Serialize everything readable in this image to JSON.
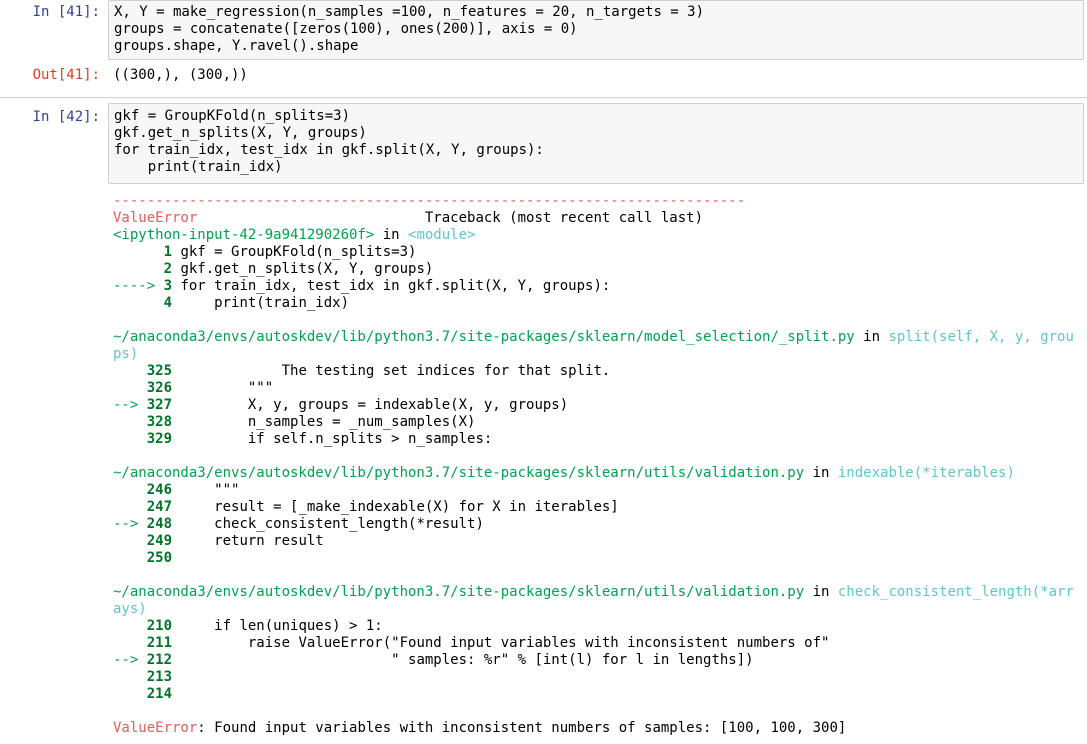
{
  "cell41": {
    "in_prompt": "In [41]:",
    "code": [
      "X, Y = make_regression(n_samples =100, n_features = 20, n_targets = 3)",
      "groups = concatenate([zeros(100), ones(200)], axis = 0)",
      "groups.shape, Y.ravel().shape"
    ],
    "out_prompt": "Out[41]:",
    "output": "((300,), (300,))"
  },
  "cell42": {
    "in_prompt": "In [42]:",
    "code": [
      "gkf = GroupKFold(n_splits=3)",
      "gkf.get_n_splits(X, Y, groups)",
      "for train_idx, test_idx in gkf.split(X, Y, groups):",
      "    print(train_idx)"
    ]
  },
  "traceback": {
    "dashes": "---------------------------------------------------------------------------",
    "error_name": "ValueError",
    "header_right": "Traceback (most recent call last)",
    "frame1": {
      "location": "<ipython-input-42-9a941290260f>",
      "in_word": " in ",
      "func": "<module>",
      "lines": [
        {
          "marker": "      ",
          "num": "1",
          "code": " gkf = GroupKFold(n_splits=3)"
        },
        {
          "marker": "      ",
          "num": "2",
          "code": " gkf.get_n_splits(X, Y, groups)"
        },
        {
          "marker": "----> ",
          "num": "3",
          "code": " for train_idx, test_idx in gkf.split(X, Y, groups):"
        },
        {
          "marker": "      ",
          "num": "4",
          "code": "     print(train_idx)"
        }
      ]
    },
    "frame2": {
      "path_line1": "~/anaconda3/envs/autoskdev/lib/python3.7/site-packages/sklearn/model_selection/_split.py",
      "in_word": " in ",
      "func_line1": "split(self, X, y, grou",
      "func_line2": "ps)",
      "lines": [
        {
          "marker": "    ",
          "num": "325",
          "code": "             The testing set indices for that split."
        },
        {
          "marker": "    ",
          "num": "326",
          "code": "         \"\"\""
        },
        {
          "marker": "--> ",
          "num": "327",
          "code": "         X, y, groups = indexable(X, y, groups)"
        },
        {
          "marker": "    ",
          "num": "328",
          "code": "         n_samples = _num_samples(X)"
        },
        {
          "marker": "    ",
          "num": "329",
          "code": "         if self.n_splits > n_samples:"
        }
      ]
    },
    "frame3": {
      "path": "~/anaconda3/envs/autoskdev/lib/python3.7/site-packages/sklearn/utils/validation.py",
      "in_word": " in ",
      "func": "indexable(*iterables)",
      "lines": [
        {
          "marker": "    ",
          "num": "246",
          "code": "     \"\"\""
        },
        {
          "marker": "    ",
          "num": "247",
          "code": "     result = [_make_indexable(X) for X in iterables]"
        },
        {
          "marker": "--> ",
          "num": "248",
          "code": "     check_consistent_length(*result)"
        },
        {
          "marker": "    ",
          "num": "249",
          "code": "     return result"
        },
        {
          "marker": "    ",
          "num": "250",
          "code": ""
        }
      ]
    },
    "frame4": {
      "path": "~/anaconda3/envs/autoskdev/lib/python3.7/site-packages/sklearn/utils/validation.py",
      "in_word": " in ",
      "func_line1": "check_consistent_length(*arr",
      "func_line2": "ays)",
      "lines": [
        {
          "marker": "    ",
          "num": "210",
          "code": "     if len(uniques) > 1:"
        },
        {
          "marker": "    ",
          "num": "211",
          "code": "         raise ValueError(\"Found input variables with inconsistent numbers of\""
        },
        {
          "marker": "--> ",
          "num": "212",
          "code": "                          \" samples: %r\" % [int(l) for l in lengths])"
        },
        {
          "marker": "    ",
          "num": "213",
          "code": ""
        },
        {
          "marker": "    ",
          "num": "214",
          "code": ""
        }
      ]
    },
    "final_error_name": "ValueError",
    "final_message": ": Found input variables with inconsistent numbers of samples: [100, 100, 300]"
  }
}
